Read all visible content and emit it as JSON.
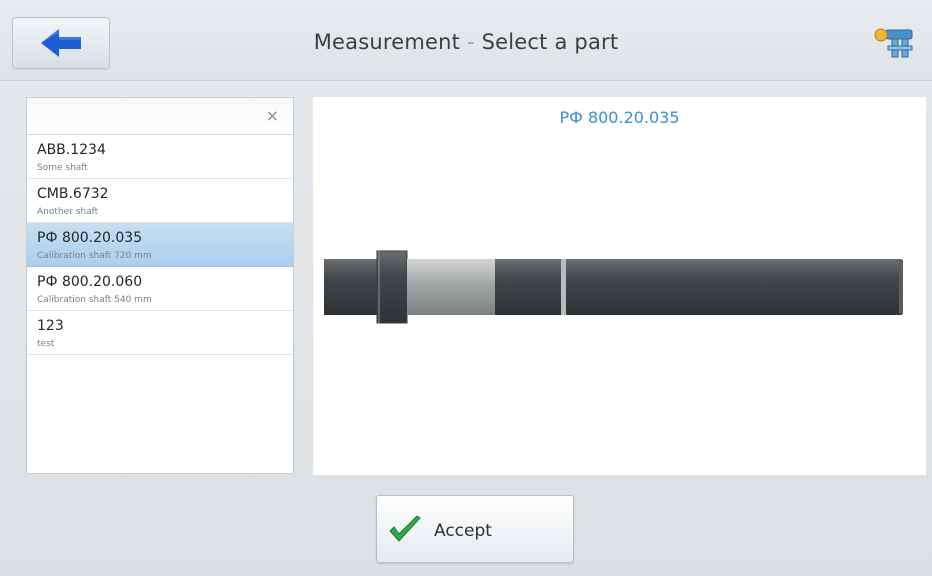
{
  "header": {
    "title_main": "Measurement",
    "title_separator": "-",
    "title_sub": "Select a part",
    "back_icon": "arrow-left-icon",
    "tool_icon": "caliper-icon"
  },
  "search": {
    "value": "",
    "clear_symbol": "×"
  },
  "parts": [
    {
      "code": "ABB.1234",
      "description": "Some shaft",
      "selected": false
    },
    {
      "code": "CMB.6732",
      "description": "Another shaft",
      "selected": false
    },
    {
      "code": "РФ 800.20.035",
      "description": "Calibration shaft 720 mm",
      "selected": true
    },
    {
      "code": "РФ 800.20.060",
      "description": "Calibration shaft 540 mm",
      "selected": false
    },
    {
      "code": "123",
      "description": "test",
      "selected": false
    }
  ],
  "preview": {
    "title": "РФ 800.20.035",
    "image": "shaft-image"
  },
  "actions": {
    "accept_label": "Accept",
    "accept_icon": "checkmark-icon"
  },
  "colors": {
    "accent": "#3a8fd6",
    "back_arrow": "#1f5fd6",
    "selected_row": "#b5d5f0",
    "check": "#2fa84a"
  }
}
